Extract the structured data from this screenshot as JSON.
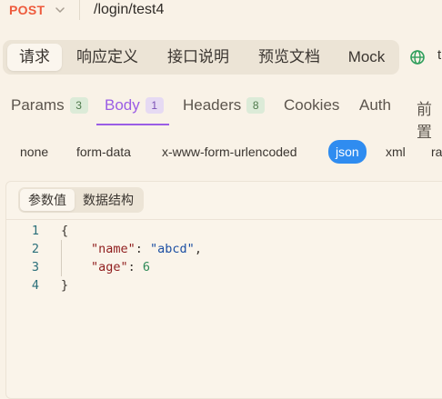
{
  "request": {
    "method": "POST",
    "url": "/login/test4"
  },
  "main_tabs": [
    {
      "label": "请求",
      "active": true
    },
    {
      "label": "响应定义",
      "active": false
    },
    {
      "label": "接口说明",
      "active": false
    },
    {
      "label": "预览文档",
      "active": false
    },
    {
      "label": "Mock",
      "active": false
    }
  ],
  "main_tab_overflow": "t",
  "request_tabs": [
    {
      "label": "Params",
      "count": "3",
      "active": false
    },
    {
      "label": "Body",
      "count": "1",
      "active": true
    },
    {
      "label": "Headers",
      "count": "8",
      "active": false
    },
    {
      "label": "Cookies",
      "active": false
    },
    {
      "label": "Auth",
      "active": false
    },
    {
      "label": "前置",
      "active": false
    }
  ],
  "body_types": [
    {
      "label": "none",
      "active": false
    },
    {
      "label": "form-data",
      "active": false
    },
    {
      "label": "x-www-form-urlencoded",
      "active": false
    },
    {
      "label": "json",
      "active": true
    },
    {
      "label": "xml",
      "active": false
    },
    {
      "label": "ra",
      "active": false
    }
  ],
  "editor": {
    "sub_tabs": [
      {
        "label": "参数值",
        "active": true
      },
      {
        "label": "数据结构",
        "active": false
      }
    ],
    "lines": [
      {
        "number": "1",
        "text": "{"
      },
      {
        "number": "2",
        "key": "\"name\"",
        "value": "\"abcd\"",
        "value_type": "string",
        "trailing": ","
      },
      {
        "number": "3",
        "key": "\"age\"",
        "value": "6",
        "value_type": "number",
        "trailing": ""
      },
      {
        "number": "4",
        "text": "}"
      }
    ]
  },
  "colors": {
    "background": "#f9f2e7",
    "method_post": "#ee5a3c",
    "active_tab": "#9b5de5",
    "json_pill": "#2f8cf0",
    "globe_icon": "#2e9e5b"
  },
  "icons": {
    "method_dropdown": "chevron-down-icon",
    "environment": "globe-icon"
  }
}
